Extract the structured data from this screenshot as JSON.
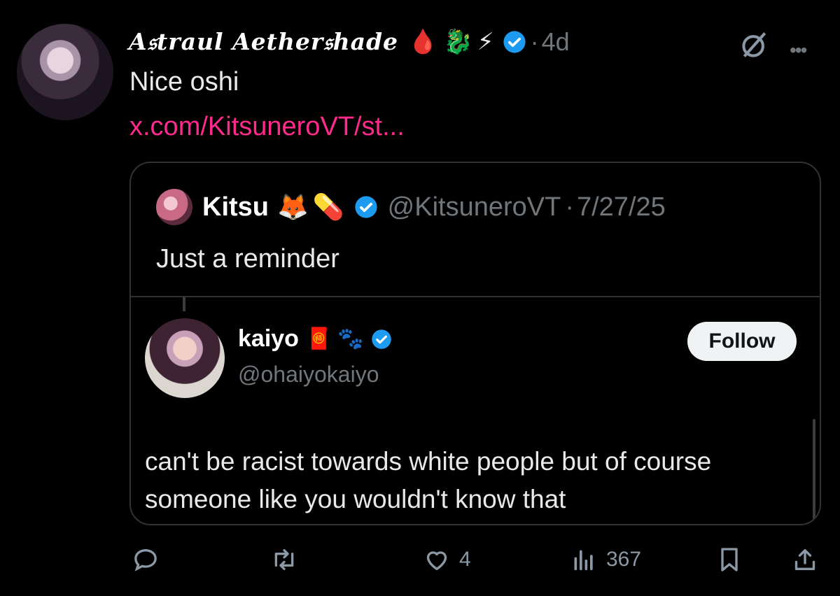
{
  "post": {
    "author_name": "A𝔰traul Aether𝔰hade",
    "name_emojis": [
      "🩸",
      "🐉",
      "⚡"
    ],
    "separator": "·",
    "time": "4d",
    "text": "Nice oshi",
    "link": "x.com/KitsuneroVT/st..."
  },
  "quote": {
    "name": "Kitsu",
    "emojis": [
      "🦊",
      "💊"
    ],
    "handle": "@KitsuneroVT",
    "separator": "·",
    "date": "7/27/25",
    "text": "Just a reminder",
    "embedded": {
      "name": "kaiyo",
      "emojis": [
        "🧧",
        "🐾"
      ],
      "handle": "@ohaiyokaiyo",
      "follow_label": "Follow",
      "text": "can't be racist towards white people but of course someone like you wouldn't know that"
    }
  },
  "actions": {
    "likes": "4",
    "views": "367"
  },
  "colors": {
    "link": "#ff2a8b",
    "verified": "#1d9bf0",
    "muted": "#71767b",
    "border": "#2f3336"
  },
  "icons": [
    "grok-icon",
    "more-icon",
    "verified-badge-icon",
    "reply-icon",
    "retweet-icon",
    "like-icon",
    "views-icon",
    "bookmark-icon",
    "share-icon"
  ]
}
